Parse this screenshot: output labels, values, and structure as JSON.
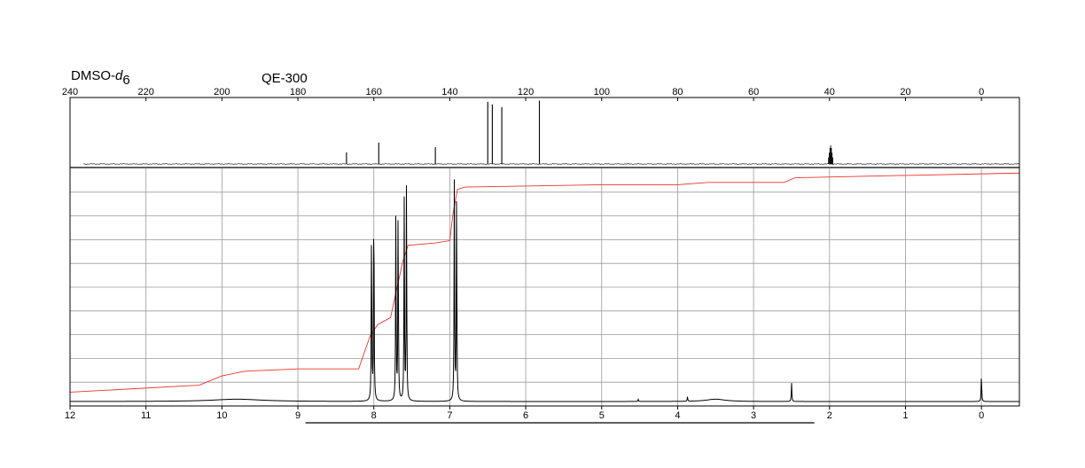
{
  "header": {
    "solvent_prefix": "DMSO-",
    "solvent_italic": "d",
    "solvent_sub": "6",
    "instrument": "QE-300"
  },
  "chart_data": [
    {
      "type": "line",
      "title": "",
      "xlabel": "",
      "ylabel": "",
      "xlim": [
        240,
        -10
      ],
      "x_reversed": true,
      "tick_labels": [
        "240",
        "220",
        "200",
        "180",
        "160",
        "140",
        "120",
        "100",
        "80",
        "60",
        "40",
        "20",
        "0"
      ],
      "tick_values": [
        240,
        220,
        200,
        180,
        160,
        140,
        120,
        100,
        80,
        60,
        40,
        20,
        0
      ],
      "axis_position": "top",
      "grid": false,
      "baseline_range": [
        236.5,
        -10
      ],
      "peaks": [
        {
          "ppm": 167.2,
          "height": 0.18
        },
        {
          "ppm": 158.7,
          "height": 0.33
        },
        {
          "ppm": 143.8,
          "height": 0.26
        },
        {
          "ppm": 130.0,
          "height": 0.96
        },
        {
          "ppm": 128.8,
          "height": 0.92
        },
        {
          "ppm": 126.3,
          "height": 0.88
        },
        {
          "ppm": 116.4,
          "height": 0.98
        }
      ],
      "solvent_multiplet": {
        "ppm": 39.7,
        "height": 0.29
      }
    },
    {
      "type": "line",
      "title": "",
      "xlabel": "",
      "ylabel": "",
      "xlim": [
        12,
        -0.5
      ],
      "x_reversed": true,
      "tick_labels": [
        "12",
        "11",
        "10",
        "9",
        "8",
        "7",
        "6",
        "5",
        "4",
        "3",
        "2",
        "1",
        "0"
      ],
      "tick_values": [
        12,
        11,
        10,
        9,
        8,
        7,
        6,
        5,
        4,
        3,
        2,
        1,
        0
      ],
      "axis_position": "bottom",
      "grid": true,
      "grid_divisions": 10,
      "colors": {
        "spectrum": "#000000",
        "integral": "#e8342e"
      },
      "peaks": [
        {
          "ppm": 8.03,
          "height": 0.78
        },
        {
          "ppm": 8.0,
          "height": 0.96
        },
        {
          "ppm": 7.71,
          "height": 0.81
        },
        {
          "ppm": 7.68,
          "height": 0.88
        },
        {
          "ppm": 7.6,
          "height": 0.86
        },
        {
          "ppm": 7.57,
          "height": 0.94
        },
        {
          "ppm": 6.94,
          "height": 0.95
        },
        {
          "ppm": 6.91,
          "height": 0.93
        },
        {
          "ppm": 4.52,
          "height": 0.01
        },
        {
          "ppm": 3.87,
          "height": 0.02
        },
        {
          "ppm": 2.5,
          "height": 0.08
        },
        {
          "ppm": 0.0,
          "height": 0.12
        }
      ],
      "broad_humps": [
        {
          "ppm": 9.8,
          "height": 0.01,
          "width": 0.4
        },
        {
          "ppm": 3.5,
          "height": 0.01,
          "width": 0.15
        }
      ],
      "integral": [
        [
          12.0,
          0.04
        ],
        [
          10.3,
          0.07
        ],
        [
          10.0,
          0.11
        ],
        [
          9.7,
          0.13
        ],
        [
          9.0,
          0.14
        ],
        [
          8.2,
          0.14
        ],
        [
          8.05,
          0.28
        ],
        [
          7.95,
          0.33
        ],
        [
          7.78,
          0.36
        ],
        [
          7.72,
          0.45
        ],
        [
          7.66,
          0.54
        ],
        [
          7.62,
          0.6
        ],
        [
          7.55,
          0.67
        ],
        [
          7.2,
          0.68
        ],
        [
          7.0,
          0.69
        ],
        [
          6.96,
          0.8
        ],
        [
          6.9,
          0.91
        ],
        [
          6.8,
          0.92
        ],
        [
          5.0,
          0.93
        ],
        [
          4.0,
          0.93
        ],
        [
          3.6,
          0.94
        ],
        [
          2.6,
          0.94
        ],
        [
          2.45,
          0.96
        ],
        [
          1.0,
          0.97
        ],
        [
          -0.5,
          0.98
        ]
      ],
      "integral_baseline_range": [
        8.9,
        2.2
      ]
    }
  ]
}
